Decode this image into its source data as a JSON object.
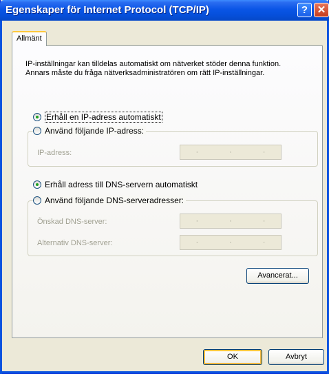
{
  "window": {
    "title": "Egenskaper för Internet Protocol (TCP/IP)",
    "help_glyph": "?",
    "close_glyph": "✕"
  },
  "tabs": [
    {
      "label": "Allmänt",
      "selected": true
    }
  ],
  "intro_text": "IP-inställningar kan tilldelas automatiskt om nätverket stöder denna funktion. Annars måste du fråga nätverksadministratören om rätt IP-inställningar.",
  "ip_section": {
    "auto_option": "Erhåll en IP-adress automatiskt",
    "auto_selected": true,
    "manual_option": "Använd följande IP-adress:",
    "fields": [
      {
        "label": "IP-adress:",
        "value": ""
      }
    ]
  },
  "dns_section": {
    "auto_option": "Erhåll adress till DNS-servern automatiskt",
    "auto_selected": true,
    "manual_option": "Använd följande DNS-serveradresser:",
    "fields": [
      {
        "label": "Önskad DNS-server:",
        "value": ""
      },
      {
        "label": "Alternativ DNS-server:",
        "value": ""
      }
    ]
  },
  "buttons": {
    "advanced": "Avancerat...",
    "ok": "OK",
    "cancel": "Avbryt"
  },
  "ip_dots": [
    "·",
    "·",
    "·"
  ]
}
